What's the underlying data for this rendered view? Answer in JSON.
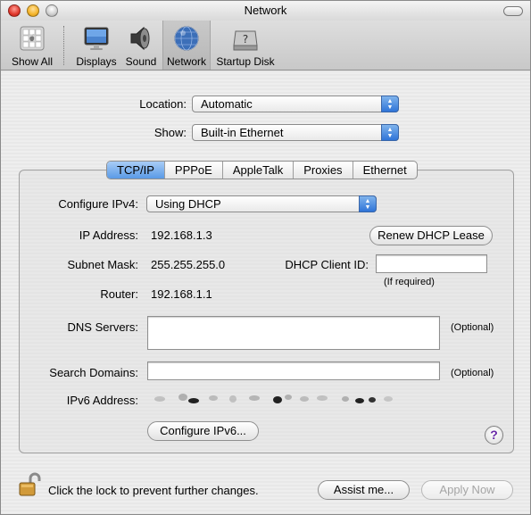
{
  "window": {
    "title": "Network"
  },
  "toolbar": {
    "items": [
      {
        "label": "Show All",
        "icon": "apple-show-all-icon"
      },
      {
        "label": "Displays",
        "icon": "display-icon"
      },
      {
        "label": "Sound",
        "icon": "speaker-icon"
      },
      {
        "label": "Network",
        "icon": "network-globe-icon",
        "selected": true
      },
      {
        "label": "Startup Disk",
        "icon": "startup-disk-icon"
      }
    ]
  },
  "location": {
    "label": "Location:",
    "value": "Automatic"
  },
  "show": {
    "label": "Show:",
    "value": "Built-in Ethernet"
  },
  "tabs": [
    {
      "label": "TCP/IP",
      "selected": true
    },
    {
      "label": "PPPoE"
    },
    {
      "label": "AppleTalk"
    },
    {
      "label": "Proxies"
    },
    {
      "label": "Ethernet"
    }
  ],
  "tcpip": {
    "configure_label": "Configure IPv4:",
    "configure_value": "Using DHCP",
    "ip_label": "IP Address:",
    "ip_value": "192.168.1.3",
    "renew_button": "Renew DHCP Lease",
    "subnet_label": "Subnet Mask:",
    "subnet_value": "255.255.255.0",
    "client_id_label": "DHCP Client ID:",
    "client_id_value": "",
    "if_required": "(If required)",
    "router_label": "Router:",
    "router_value": "192.168.1.1",
    "dns_label": "DNS Servers:",
    "dns_value": "",
    "optional_1": "(Optional)",
    "search_label": "Search Domains:",
    "search_value": "",
    "optional_2": "(Optional)",
    "ipv6_label": "IPv6 Address:",
    "configure_ipv6_button": "Configure IPv6..."
  },
  "footer": {
    "lock_text": "Click the lock to prevent further changes.",
    "assist_button": "Assist me...",
    "apply_button": "Apply Now"
  },
  "colors": {
    "accent": "#3b7fe0",
    "help_glyph": "#6a2aa8"
  }
}
